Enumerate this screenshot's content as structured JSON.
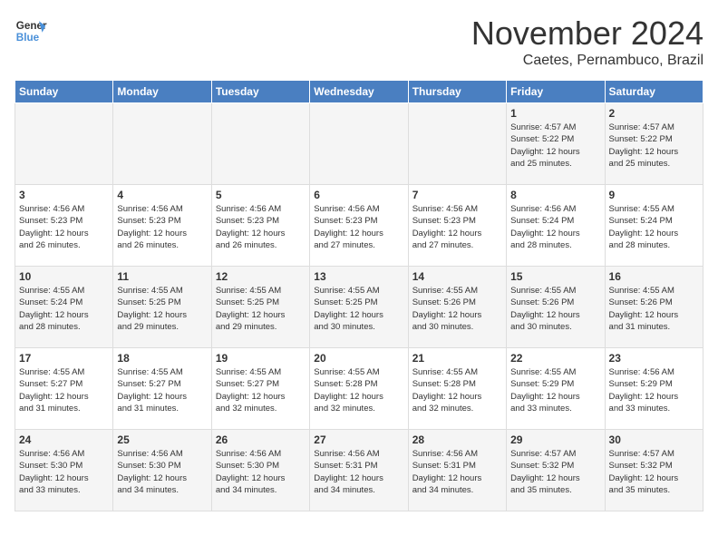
{
  "header": {
    "logo_line1": "General",
    "logo_line2": "Blue",
    "month": "November 2024",
    "location": "Caetes, Pernambuco, Brazil"
  },
  "weekdays": [
    "Sunday",
    "Monday",
    "Tuesday",
    "Wednesday",
    "Thursday",
    "Friday",
    "Saturday"
  ],
  "weeks": [
    [
      {
        "day": "",
        "info": ""
      },
      {
        "day": "",
        "info": ""
      },
      {
        "day": "",
        "info": ""
      },
      {
        "day": "",
        "info": ""
      },
      {
        "day": "",
        "info": ""
      },
      {
        "day": "1",
        "info": "Sunrise: 4:57 AM\nSunset: 5:22 PM\nDaylight: 12 hours\nand 25 minutes."
      },
      {
        "day": "2",
        "info": "Sunrise: 4:57 AM\nSunset: 5:22 PM\nDaylight: 12 hours\nand 25 minutes."
      }
    ],
    [
      {
        "day": "3",
        "info": "Sunrise: 4:56 AM\nSunset: 5:23 PM\nDaylight: 12 hours\nand 26 minutes."
      },
      {
        "day": "4",
        "info": "Sunrise: 4:56 AM\nSunset: 5:23 PM\nDaylight: 12 hours\nand 26 minutes."
      },
      {
        "day": "5",
        "info": "Sunrise: 4:56 AM\nSunset: 5:23 PM\nDaylight: 12 hours\nand 26 minutes."
      },
      {
        "day": "6",
        "info": "Sunrise: 4:56 AM\nSunset: 5:23 PM\nDaylight: 12 hours\nand 27 minutes."
      },
      {
        "day": "7",
        "info": "Sunrise: 4:56 AM\nSunset: 5:23 PM\nDaylight: 12 hours\nand 27 minutes."
      },
      {
        "day": "8",
        "info": "Sunrise: 4:56 AM\nSunset: 5:24 PM\nDaylight: 12 hours\nand 28 minutes."
      },
      {
        "day": "9",
        "info": "Sunrise: 4:55 AM\nSunset: 5:24 PM\nDaylight: 12 hours\nand 28 minutes."
      }
    ],
    [
      {
        "day": "10",
        "info": "Sunrise: 4:55 AM\nSunset: 5:24 PM\nDaylight: 12 hours\nand 28 minutes."
      },
      {
        "day": "11",
        "info": "Sunrise: 4:55 AM\nSunset: 5:25 PM\nDaylight: 12 hours\nand 29 minutes."
      },
      {
        "day": "12",
        "info": "Sunrise: 4:55 AM\nSunset: 5:25 PM\nDaylight: 12 hours\nand 29 minutes."
      },
      {
        "day": "13",
        "info": "Sunrise: 4:55 AM\nSunset: 5:25 PM\nDaylight: 12 hours\nand 30 minutes."
      },
      {
        "day": "14",
        "info": "Sunrise: 4:55 AM\nSunset: 5:26 PM\nDaylight: 12 hours\nand 30 minutes."
      },
      {
        "day": "15",
        "info": "Sunrise: 4:55 AM\nSunset: 5:26 PM\nDaylight: 12 hours\nand 30 minutes."
      },
      {
        "day": "16",
        "info": "Sunrise: 4:55 AM\nSunset: 5:26 PM\nDaylight: 12 hours\nand 31 minutes."
      }
    ],
    [
      {
        "day": "17",
        "info": "Sunrise: 4:55 AM\nSunset: 5:27 PM\nDaylight: 12 hours\nand 31 minutes."
      },
      {
        "day": "18",
        "info": "Sunrise: 4:55 AM\nSunset: 5:27 PM\nDaylight: 12 hours\nand 31 minutes."
      },
      {
        "day": "19",
        "info": "Sunrise: 4:55 AM\nSunset: 5:27 PM\nDaylight: 12 hours\nand 32 minutes."
      },
      {
        "day": "20",
        "info": "Sunrise: 4:55 AM\nSunset: 5:28 PM\nDaylight: 12 hours\nand 32 minutes."
      },
      {
        "day": "21",
        "info": "Sunrise: 4:55 AM\nSunset: 5:28 PM\nDaylight: 12 hours\nand 32 minutes."
      },
      {
        "day": "22",
        "info": "Sunrise: 4:55 AM\nSunset: 5:29 PM\nDaylight: 12 hours\nand 33 minutes."
      },
      {
        "day": "23",
        "info": "Sunrise: 4:56 AM\nSunset: 5:29 PM\nDaylight: 12 hours\nand 33 minutes."
      }
    ],
    [
      {
        "day": "24",
        "info": "Sunrise: 4:56 AM\nSunset: 5:30 PM\nDaylight: 12 hours\nand 33 minutes."
      },
      {
        "day": "25",
        "info": "Sunrise: 4:56 AM\nSunset: 5:30 PM\nDaylight: 12 hours\nand 34 minutes."
      },
      {
        "day": "26",
        "info": "Sunrise: 4:56 AM\nSunset: 5:30 PM\nDaylight: 12 hours\nand 34 minutes."
      },
      {
        "day": "27",
        "info": "Sunrise: 4:56 AM\nSunset: 5:31 PM\nDaylight: 12 hours\nand 34 minutes."
      },
      {
        "day": "28",
        "info": "Sunrise: 4:56 AM\nSunset: 5:31 PM\nDaylight: 12 hours\nand 34 minutes."
      },
      {
        "day": "29",
        "info": "Sunrise: 4:57 AM\nSunset: 5:32 PM\nDaylight: 12 hours\nand 35 minutes."
      },
      {
        "day": "30",
        "info": "Sunrise: 4:57 AM\nSunset: 5:32 PM\nDaylight: 12 hours\nand 35 minutes."
      }
    ]
  ]
}
